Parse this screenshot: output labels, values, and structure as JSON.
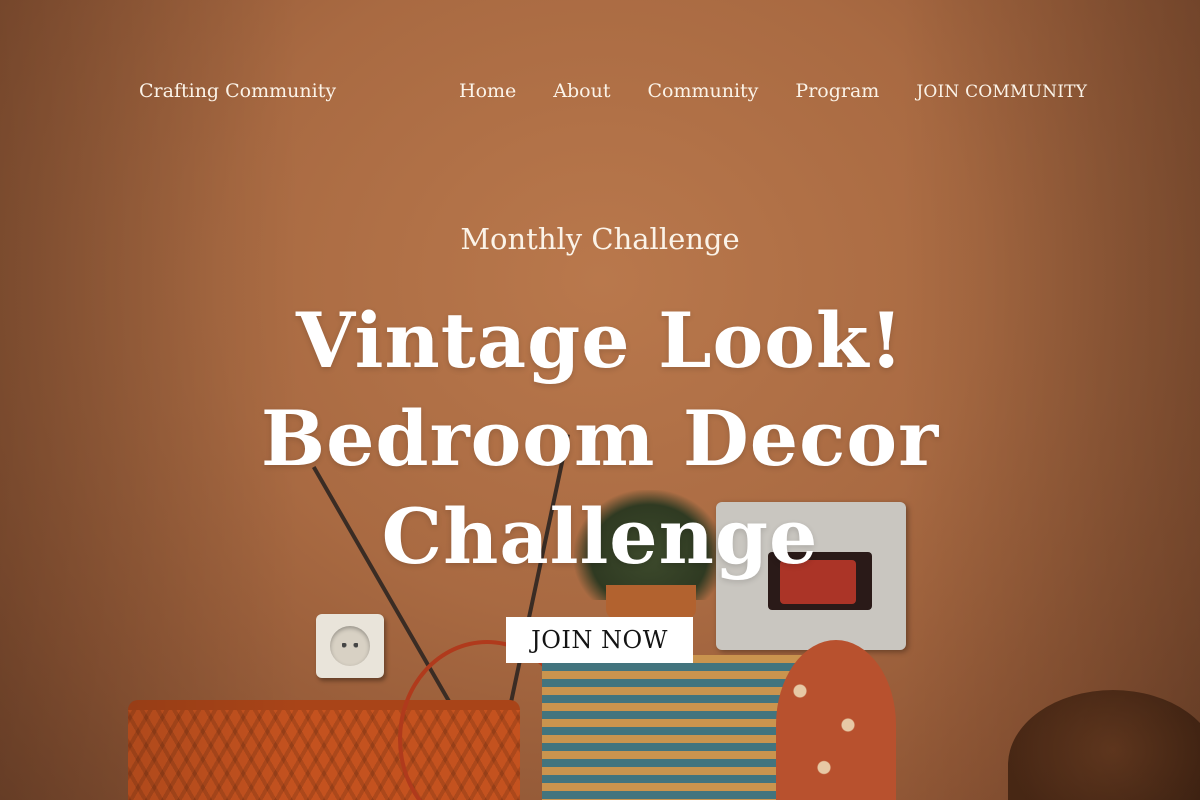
{
  "nav": {
    "brand": "Crafting Community",
    "links": [
      "Home",
      "About",
      "Community",
      "Program"
    ],
    "cta": "JOIN COMMUNITY"
  },
  "hero": {
    "eyebrow": "Monthly Challenge",
    "headline_lines": [
      "Vintage Look!",
      "Bedroom Decor",
      "Challenge"
    ],
    "button": "JOIN NOW"
  },
  "colors": {
    "background": "#a86a43",
    "text": "#fbf3e8",
    "button_bg": "#ffffff",
    "button_text": "#141414"
  }
}
